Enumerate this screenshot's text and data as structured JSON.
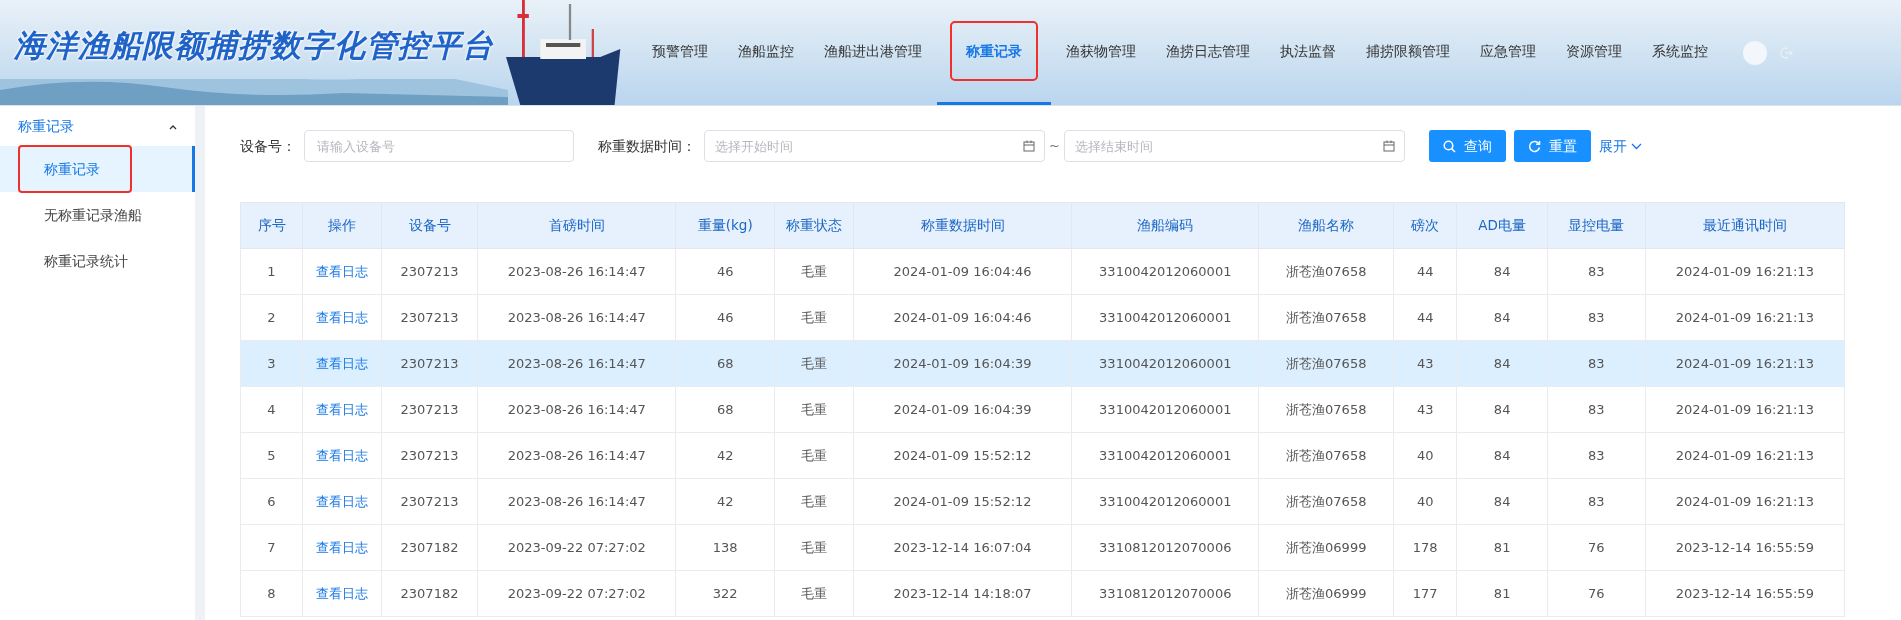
{
  "header": {
    "title": "海洋渔船限额捕捞数字化管控平台",
    "nav": [
      {
        "label": "预警管理",
        "selected": false
      },
      {
        "label": "渔船监控",
        "selected": false
      },
      {
        "label": "渔船进出港管理",
        "selected": false
      },
      {
        "label": "称重记录",
        "selected": true
      },
      {
        "label": "渔获物管理",
        "selected": false
      },
      {
        "label": "渔捞日志管理",
        "selected": false
      },
      {
        "label": "执法监督",
        "selected": false
      },
      {
        "label": "捕捞限额管理",
        "selected": false
      },
      {
        "label": "应急管理",
        "selected": false
      },
      {
        "label": "资源管理",
        "selected": false
      },
      {
        "label": "系统监控",
        "selected": false
      }
    ]
  },
  "sidebar": {
    "group": {
      "label": "称重记录",
      "expanded": true
    },
    "items": [
      {
        "label": "称重记录",
        "selected": true
      },
      {
        "label": "无称重记录渔船",
        "selected": false
      },
      {
        "label": "称重记录统计",
        "selected": false
      }
    ]
  },
  "filters": {
    "device": {
      "label": "设备号：",
      "placeholder": "请输入设备号"
    },
    "time": {
      "label": "称重数据时间：",
      "start_placeholder": "选择开始时间",
      "separator": "~",
      "end_placeholder": "选择结束时间"
    },
    "buttons": [
      {
        "label": "查询",
        "kind": "search"
      },
      {
        "label": "重置",
        "kind": "reset"
      }
    ],
    "expand": {
      "label": "展开",
      "expanded": false
    }
  },
  "table": {
    "columns": [
      {
        "label": "序号",
        "kind": "text"
      },
      {
        "label": "操作",
        "kind": "link"
      },
      {
        "label": "设备号",
        "kind": "text"
      },
      {
        "label": "首磅时间",
        "kind": "text"
      },
      {
        "label": "重量(kg)",
        "kind": "text"
      },
      {
        "label": "称重状态",
        "kind": "text"
      },
      {
        "label": "称重数据时间",
        "kind": "text"
      },
      {
        "label": "渔船编码",
        "kind": "text"
      },
      {
        "label": "渔船名称",
        "kind": "text"
      },
      {
        "label": "磅次",
        "kind": "text"
      },
      {
        "label": "AD电量",
        "kind": "text"
      },
      {
        "label": "显控电量",
        "kind": "text"
      },
      {
        "label": "最近通讯时间",
        "kind": "text"
      }
    ],
    "rows": [
      {
        "selected": false,
        "cells": [
          "1",
          "查看日志",
          "2307213",
          "2023-08-26 16:14:47",
          "46",
          "毛重",
          "2024-01-09 16:04:46",
          "3310042012060001",
          "浙苍渔07658",
          "44",
          "84",
          "83",
          "2024-01-09 16:21:13"
        ]
      },
      {
        "selected": false,
        "cells": [
          "2",
          "查看日志",
          "2307213",
          "2023-08-26 16:14:47",
          "46",
          "毛重",
          "2024-01-09 16:04:46",
          "3310042012060001",
          "浙苍渔07658",
          "44",
          "84",
          "83",
          "2024-01-09 16:21:13"
        ]
      },
      {
        "selected": true,
        "cells": [
          "3",
          "查看日志",
          "2307213",
          "2023-08-26 16:14:47",
          "68",
          "毛重",
          "2024-01-09 16:04:39",
          "3310042012060001",
          "浙苍渔07658",
          "43",
          "84",
          "83",
          "2024-01-09 16:21:13"
        ]
      },
      {
        "selected": false,
        "cells": [
          "4",
          "查看日志",
          "2307213",
          "2023-08-26 16:14:47",
          "68",
          "毛重",
          "2024-01-09 16:04:39",
          "3310042012060001",
          "浙苍渔07658",
          "43",
          "84",
          "83",
          "2024-01-09 16:21:13"
        ]
      },
      {
        "selected": false,
        "cells": [
          "5",
          "查看日志",
          "2307213",
          "2023-08-26 16:14:47",
          "42",
          "毛重",
          "2024-01-09 15:52:12",
          "3310042012060001",
          "浙苍渔07658",
          "40",
          "84",
          "83",
          "2024-01-09 16:21:13"
        ]
      },
      {
        "selected": false,
        "cells": [
          "6",
          "查看日志",
          "2307213",
          "2023-08-26 16:14:47",
          "42",
          "毛重",
          "2024-01-09 15:52:12",
          "3310042012060001",
          "浙苍渔07658",
          "40",
          "84",
          "83",
          "2024-01-09 16:21:13"
        ]
      },
      {
        "selected": false,
        "cells": [
          "7",
          "查看日志",
          "2307182",
          "2023-09-22 07:27:02",
          "138",
          "毛重",
          "2023-12-14 16:07:04",
          "3310812012070006",
          "浙苍渔06999",
          "178",
          "81",
          "76",
          "2023-12-14 16:55:59"
        ]
      },
      {
        "selected": false,
        "cells": [
          "8",
          "查看日志",
          "2307182",
          "2023-09-22 07:27:02",
          "322",
          "毛重",
          "2023-12-14 14:18:07",
          "3310812012070006",
          "浙苍渔06999",
          "177",
          "81",
          "76",
          "2023-12-14 16:55:59"
        ]
      }
    ]
  }
}
